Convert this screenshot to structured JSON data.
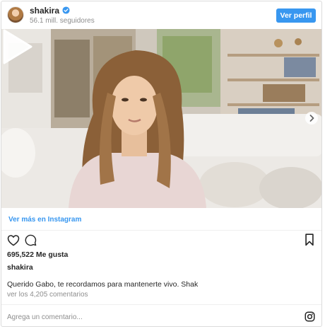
{
  "header": {
    "username": "shakira",
    "followers": "56.1 mill. seguidores",
    "profile_button": "Ver perfil",
    "verified_icon": "verified-badge-icon"
  },
  "media": {
    "type": "video",
    "play_icon": "play-icon",
    "next_icon": "chevron-right-icon"
  },
  "link": {
    "label": "Ver más en Instagram"
  },
  "actions": {
    "like_icon": "heart-icon",
    "comment_icon": "comment-icon",
    "save_icon": "bookmark-icon"
  },
  "post": {
    "likes": "695,522 Me gusta",
    "owner": "shakira",
    "caption": "Querido Gabo, te recordamos para mantenerte vivo. Shak",
    "comments_link": "ver los 4,205 comentarios"
  },
  "comment_box": {
    "placeholder": "Agrega un comentario...",
    "instagram_icon": "instagram-logo-icon"
  },
  "colors": {
    "accent": "#3897f0",
    "text": "#262626",
    "muted": "#8e8e8e",
    "border": "#dbdbdb"
  }
}
